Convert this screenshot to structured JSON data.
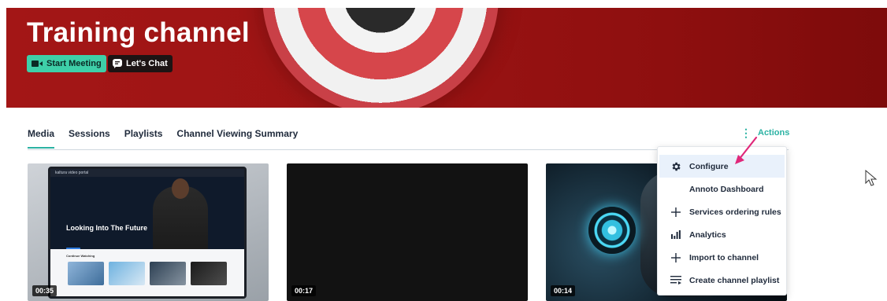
{
  "banner": {
    "title": "Training channel",
    "start_meeting_label": "Start Meeting",
    "lets_chat_label": "Let's Chat"
  },
  "tabs": [
    {
      "label": "Media",
      "active": true
    },
    {
      "label": "Sessions",
      "active": false
    },
    {
      "label": "Playlists",
      "active": false
    },
    {
      "label": "Channel Viewing Summary",
      "active": false
    }
  ],
  "actions": {
    "label": "Actions",
    "icon": "kebab-icon"
  },
  "thumbnails": [
    {
      "duration": "00:35",
      "screen": {
        "app_name": "kaltura video portal",
        "title": "Looking Into The Future",
        "section": "Continue Watching"
      }
    },
    {
      "duration": "00:17"
    },
    {
      "duration": "00:14"
    }
  ],
  "menu": {
    "items": [
      {
        "label": "Configure",
        "icon": "gear-icon",
        "highlighted": true
      },
      {
        "label": "Annoto Dashboard",
        "icon": "",
        "highlighted": false
      },
      {
        "label": "Services ordering rules",
        "icon": "plus-icon",
        "highlighted": false
      },
      {
        "label": "Analytics",
        "icon": "bar-chart-icon",
        "highlighted": false
      },
      {
        "label": "Import to channel",
        "icon": "plus-icon",
        "highlighted": false
      },
      {
        "label": "Create channel playlist",
        "icon": "playlist-add-icon",
        "highlighted": false
      }
    ]
  },
  "colors": {
    "banner": "#9d1414",
    "accent": "#2bb2a3",
    "meeting_button": "#3ecfa8",
    "chat_button": "#1d1414",
    "annotation_arrow": "#e0287a",
    "menu_highlight": "#e9f1fb"
  }
}
